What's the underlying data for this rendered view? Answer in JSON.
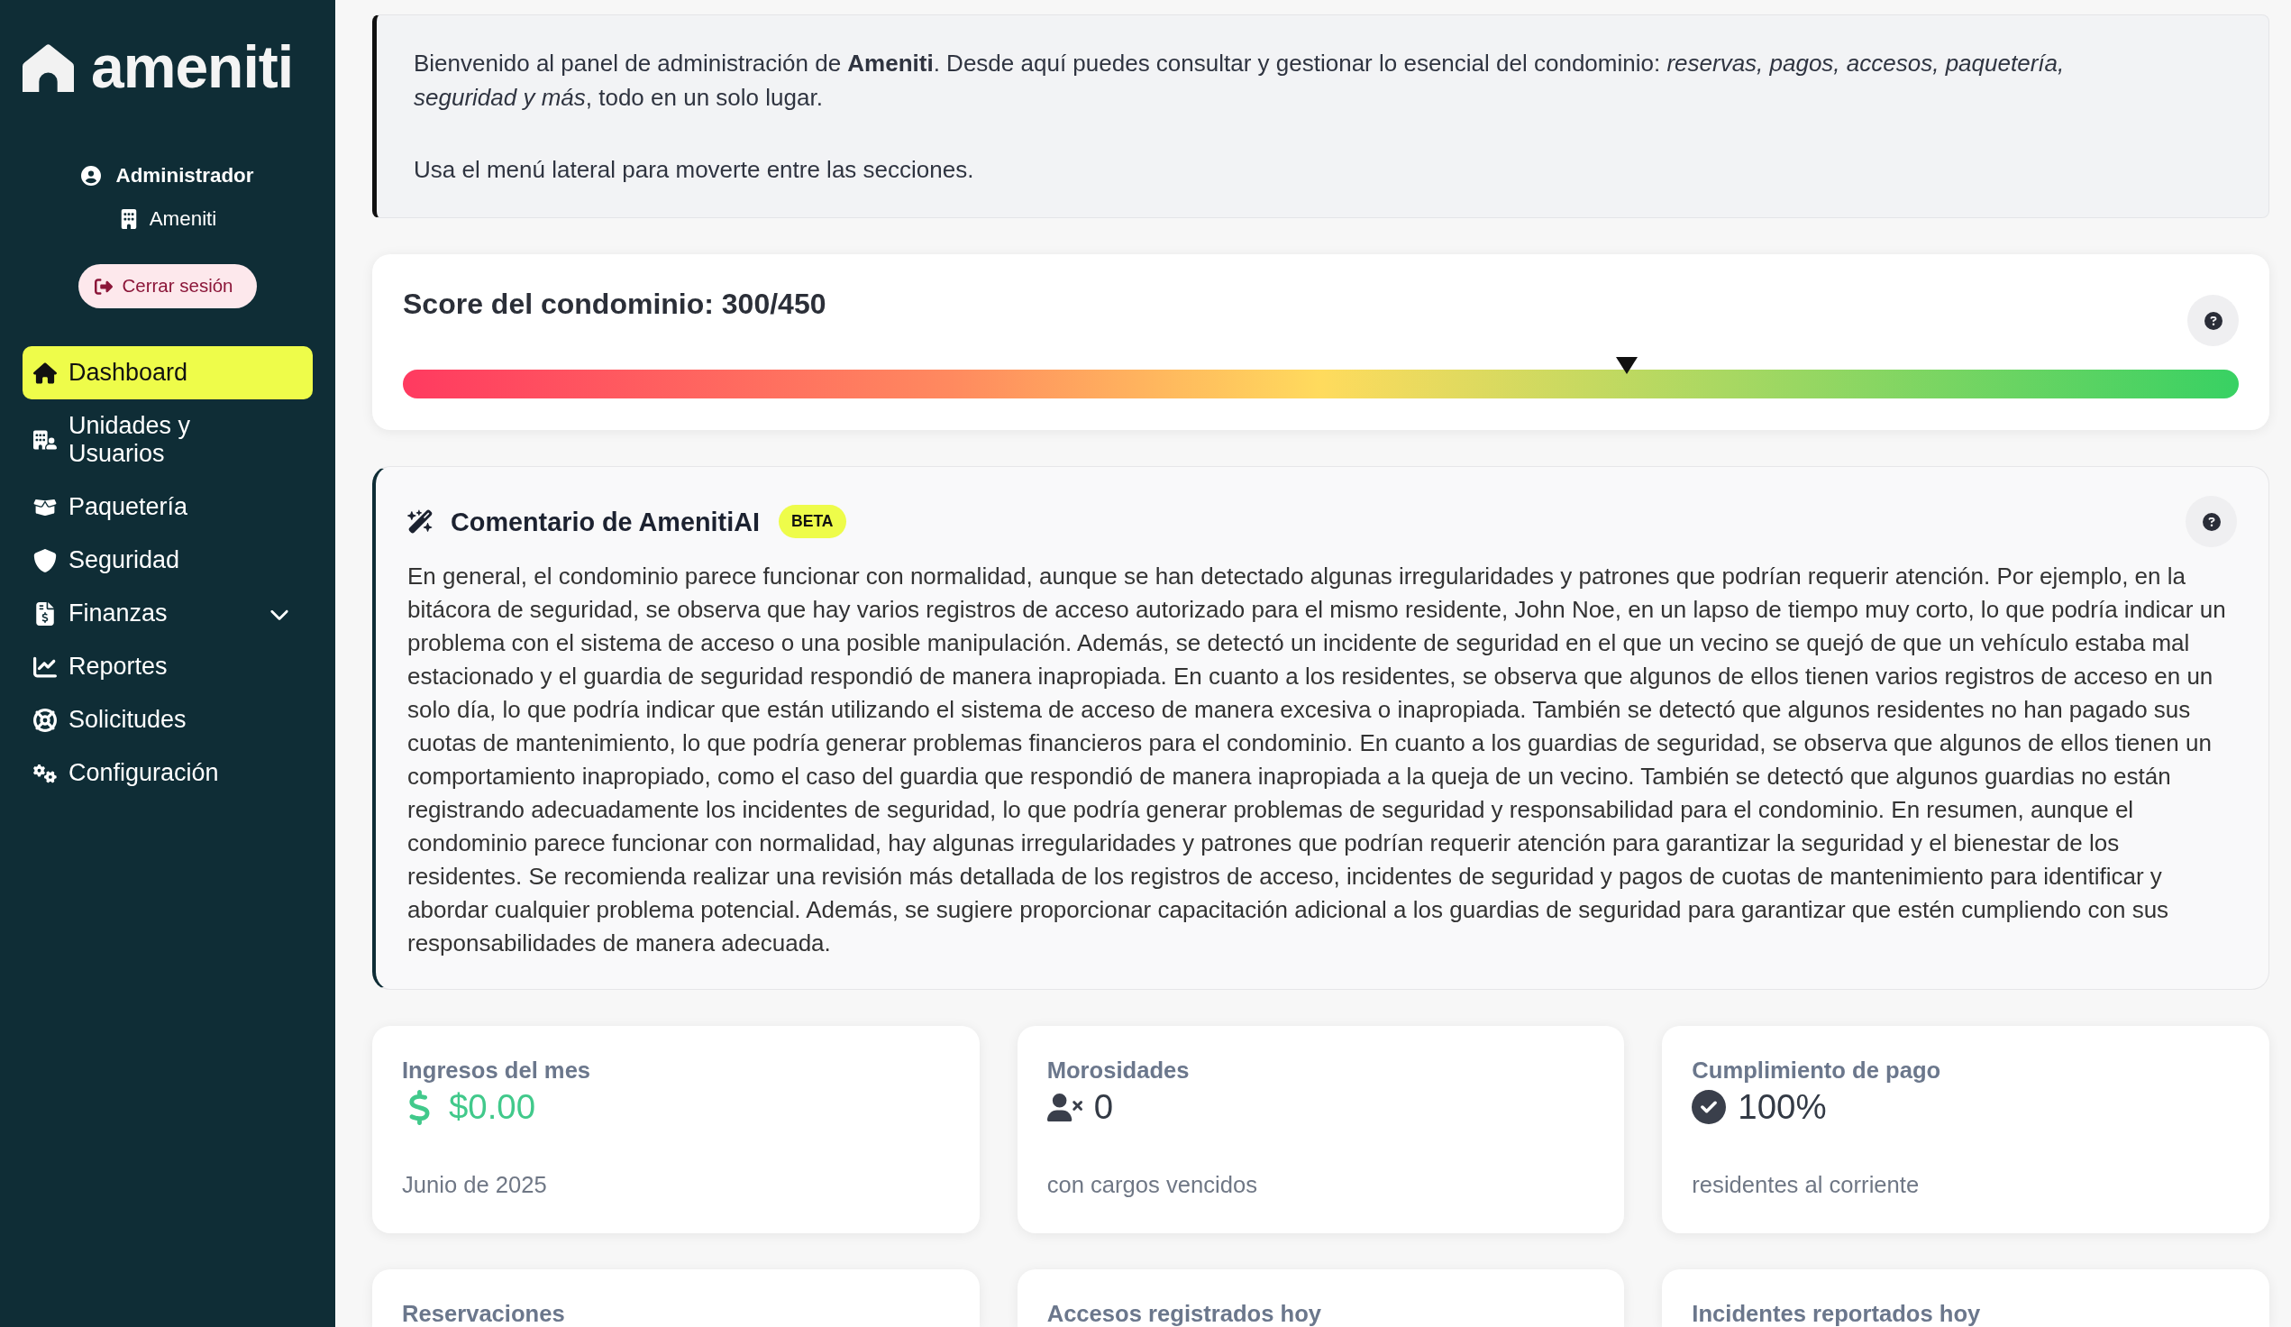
{
  "sidebar": {
    "brand": "ameniti",
    "user": {
      "name": "Administrador",
      "organization": "Ameniti"
    },
    "logout_button": "Cerrar sesión",
    "nav": [
      {
        "kind": "link",
        "label": "Dashboard",
        "selected": true
      },
      {
        "kind": "link",
        "label": "Unidades y Usuarios",
        "selected": false
      },
      {
        "kind": "link",
        "label": "Paquetería",
        "selected": false
      },
      {
        "kind": "link",
        "label": "Seguridad",
        "selected": false
      },
      {
        "kind": "group",
        "label": "Finanzas",
        "selected": false,
        "expanded": false
      },
      {
        "kind": "link",
        "label": "Reportes",
        "selected": false
      },
      {
        "kind": "link",
        "label": "Solicitudes",
        "selected": false
      },
      {
        "kind": "link",
        "label": "Configuración",
        "selected": false
      }
    ]
  },
  "intro": {
    "paragraphs": [
      "Bienvenido al panel de administración de **Ameniti**. Desde aquí puedes consultar y gestionar lo esencial del condominio: *reservas, pagos, accesos, paquetería, seguridad y más*, todo en un solo lugar.",
      "Usa el menú lateral para moverte entre las secciones."
    ]
  },
  "score": {
    "title": "Score del condominio: 300/450",
    "level": 0.6667
  },
  "ai_comment": {
    "title": "Comentario de AmenitiAI",
    "badge": "BETA",
    "text": "En general, el condominio parece funcionar con normalidad, aunque se han detectado algunas irregularidades y patrones que podrían requerir atención. Por ejemplo, en la bitácora de seguridad, se observa que hay varios registros de acceso autorizado para el mismo residente, John Noe, en un lapso de tiempo muy corto, lo que podría indicar un problema con el sistema de acceso o una posible manipulación. Además, se detectó un incidente de seguridad en el que un vecino se quejó de que un vehículo estaba mal estacionado y el guardia de seguridad respondió de manera inapropiada. En cuanto a los residentes, se observa que algunos de ellos tienen varios registros de acceso en un solo día, lo que podría indicar que están utilizando el sistema de acceso de manera excesiva o inapropiada. También se detectó que algunos residentes no han pagado sus cuotas de mantenimiento, lo que podría generar problemas financieros para el condominio. En cuanto a los guardias de seguridad, se observa que algunos de ellos tienen un comportamiento inapropiado, como el caso del guardia que respondió de manera inapropiada a la queja de un vecino. También se detectó que algunos guardias no están registrando adecuadamente los incidentes de seguridad, lo que podría generar problemas de seguridad y responsabilidad para el condominio. En resumen, aunque el condominio parece funcionar con normalidad, hay algunas irregularidades y patrones que podrían requerir atención para garantizar la seguridad y el bienestar de los residentes. Se recomienda realizar una revisión más detallada de los registros de acceso, incidentes de seguridad y pagos de cuotas de mantenimiento para identificar y abordar cualquier problema potencial. Además, se sugiere proporcionar capacitación adicional a los guardias de seguridad para garantizar que estén cumpliendo con sus responsabilidades de manera adecuada."
  },
  "stats": [
    {
      "kind": "income",
      "label": "Ingresos del mes",
      "value": "$0.00",
      "caption": "Junio de 2025"
    },
    {
      "kind": "overdue",
      "label": "Morosidades",
      "value": "0",
      "caption": "con cargos vencidos"
    },
    {
      "kind": "compliance",
      "label": "Cumplimiento de pago",
      "value": "100%",
      "caption": "residentes al corriente"
    }
  ],
  "stats_row_2": [
    "Reservaciones",
    "Accesos registrados hoy",
    "Incidentes reportados hoy"
  ]
}
